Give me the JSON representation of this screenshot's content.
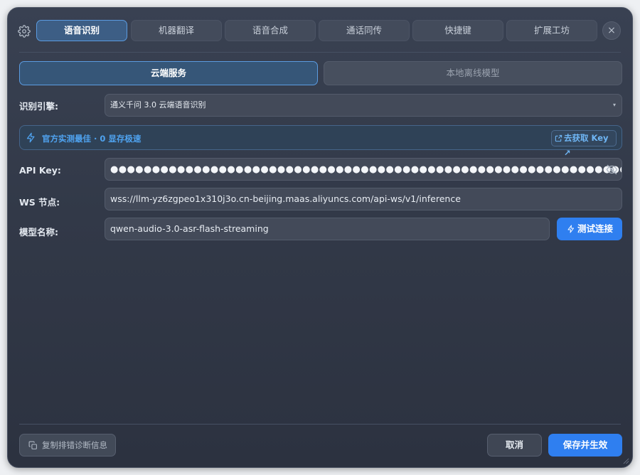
{
  "tabs": [
    "语音识别",
    "机器翻译",
    "语音合成",
    "通话同传",
    "快捷键",
    "扩展工坊"
  ],
  "active_tab": "语音识别",
  "close_label": "×",
  "segments": {
    "cloud": "云端服务",
    "local": "本地离线模型"
  },
  "engine": {
    "label": "识别引擎:",
    "value": "通义千问 3.0 云端语音识别",
    "arrow": "▾"
  },
  "banner": {
    "text": "官方实测最佳 · 0 显存极速",
    "link": "去获取 Key ↗"
  },
  "api_key": {
    "label": "API Key:",
    "masked": "●●●●●●●●●●●●●●●●●●●●●●●●●●●●●●●●●●●●●●●●●●●●●●●●●●●●●●●●●●●●●●●●●●●●●●●●●"
  },
  "ws": {
    "label": "WS 节点:",
    "value": "wss://llm-yz6zgpeo1x310j3o.cn-beijing.maas.aliyuncs.com/api-ws/v1/inference"
  },
  "model": {
    "label": "模型名称:",
    "value": "qwen-audio-3.0-asr-flash-streaming"
  },
  "buttons": {
    "test": "测试连接",
    "copy": "复制排错诊断信息",
    "cancel": "取消",
    "save": "保存并生效"
  },
  "colors": {
    "accent": "#2f7ff0",
    "link": "#4fa3f0",
    "window_bg": "#343b4a"
  },
  "icons": {
    "settings": "gear-icon",
    "bolt": "lightning-icon",
    "eye": "eye-off-icon",
    "copy": "copy-icon",
    "external": "external-link-icon"
  }
}
